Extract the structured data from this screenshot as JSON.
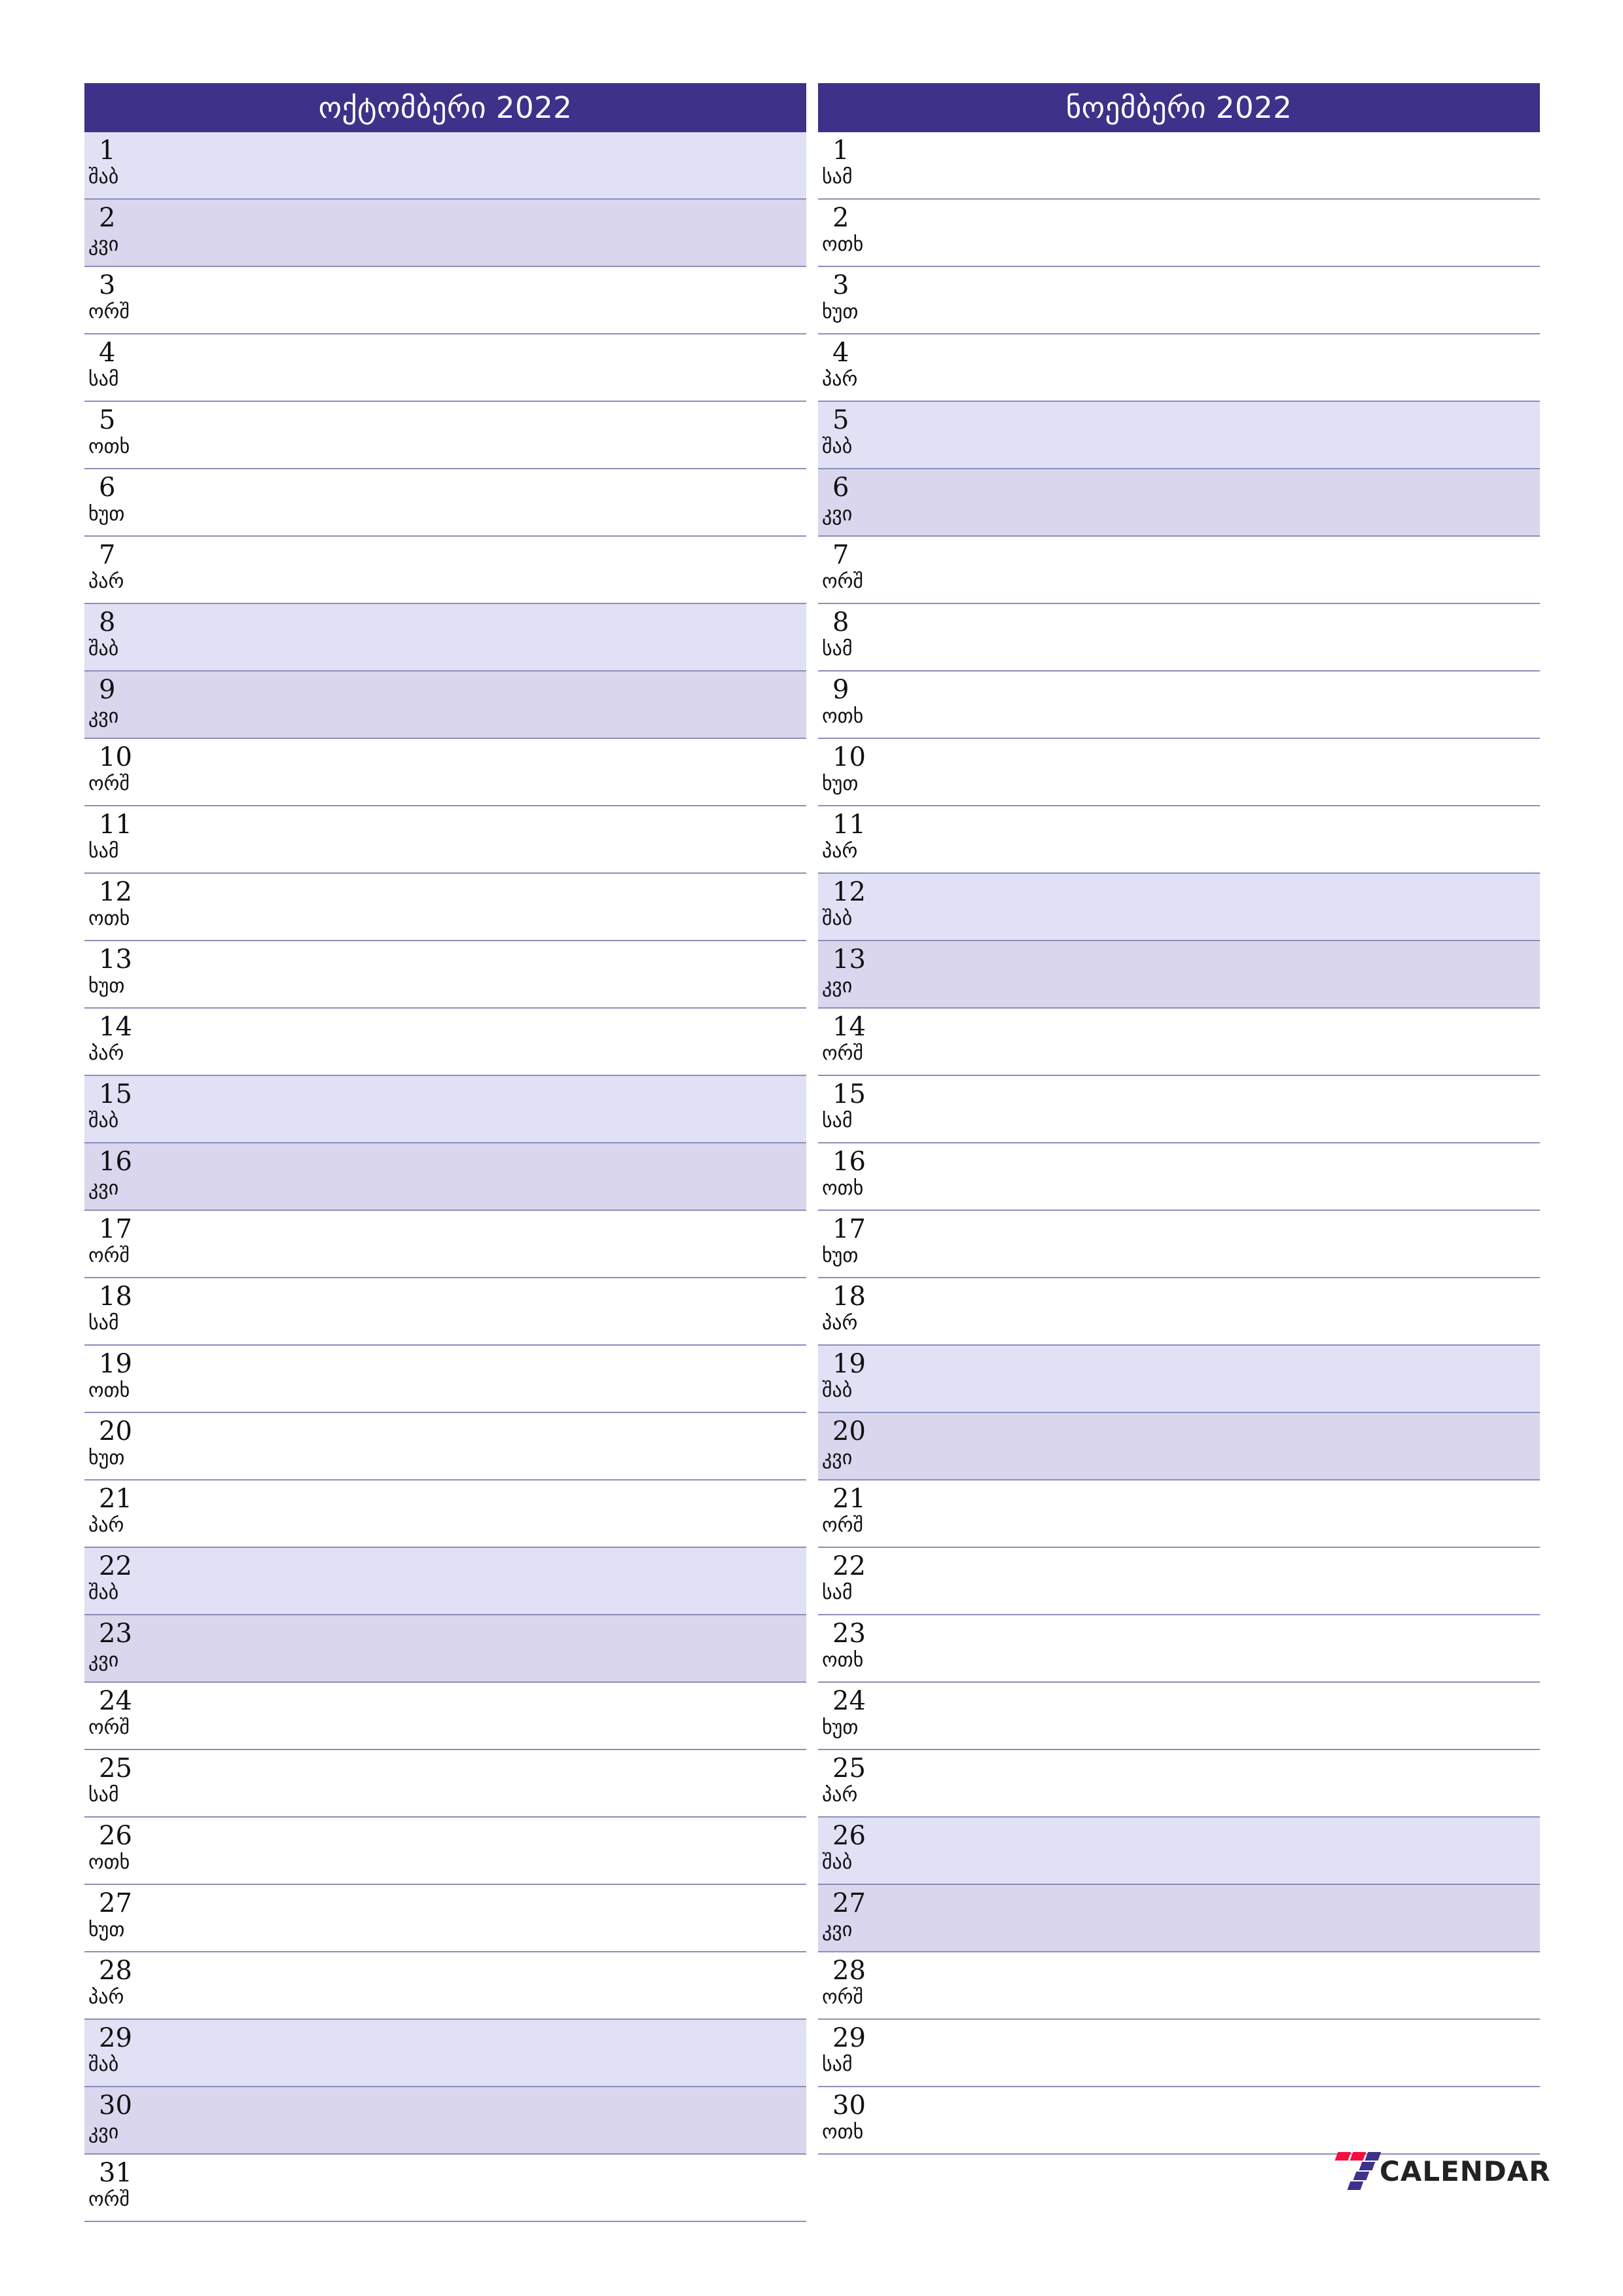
{
  "colors": {
    "header_bg": "#3d3189",
    "header_text": "#ffffff",
    "saturday_bg": "#e0e1f5",
    "sunday_bg": "#d9d6ed",
    "row_line": "#8f8cba",
    "brand_red": "#f40f3e",
    "brand_purple": "#3d3189"
  },
  "brand": {
    "name": "CALENDAR",
    "mark": "seven-logo-icon"
  },
  "months": [
    {
      "title": "ოქტომბერი 2022",
      "days": [
        {
          "num": "1",
          "weekday": "შაბ",
          "type": "sat"
        },
        {
          "num": "2",
          "weekday": "კვი",
          "type": "sun"
        },
        {
          "num": "3",
          "weekday": "ორშ",
          "type": "wd"
        },
        {
          "num": "4",
          "weekday": "სამ",
          "type": "wd"
        },
        {
          "num": "5",
          "weekday": "ოთხ",
          "type": "wd"
        },
        {
          "num": "6",
          "weekday": "ხუთ",
          "type": "wd"
        },
        {
          "num": "7",
          "weekday": "პარ",
          "type": "wd"
        },
        {
          "num": "8",
          "weekday": "შაბ",
          "type": "sat"
        },
        {
          "num": "9",
          "weekday": "კვი",
          "type": "sun"
        },
        {
          "num": "10",
          "weekday": "ორშ",
          "type": "wd"
        },
        {
          "num": "11",
          "weekday": "სამ",
          "type": "wd"
        },
        {
          "num": "12",
          "weekday": "ოთხ",
          "type": "wd"
        },
        {
          "num": "13",
          "weekday": "ხუთ",
          "type": "wd"
        },
        {
          "num": "14",
          "weekday": "პარ",
          "type": "wd"
        },
        {
          "num": "15",
          "weekday": "შაბ",
          "type": "sat"
        },
        {
          "num": "16",
          "weekday": "კვი",
          "type": "sun"
        },
        {
          "num": "17",
          "weekday": "ორშ",
          "type": "wd"
        },
        {
          "num": "18",
          "weekday": "სამ",
          "type": "wd"
        },
        {
          "num": "19",
          "weekday": "ოთხ",
          "type": "wd"
        },
        {
          "num": "20",
          "weekday": "ხუთ",
          "type": "wd"
        },
        {
          "num": "21",
          "weekday": "პარ",
          "type": "wd"
        },
        {
          "num": "22",
          "weekday": "შაბ",
          "type": "sat"
        },
        {
          "num": "23",
          "weekday": "კვი",
          "type": "sun"
        },
        {
          "num": "24",
          "weekday": "ორშ",
          "type": "wd"
        },
        {
          "num": "25",
          "weekday": "სამ",
          "type": "wd"
        },
        {
          "num": "26",
          "weekday": "ოთხ",
          "type": "wd"
        },
        {
          "num": "27",
          "weekday": "ხუთ",
          "type": "wd"
        },
        {
          "num": "28",
          "weekday": "პარ",
          "type": "wd"
        },
        {
          "num": "29",
          "weekday": "შაბ",
          "type": "sat"
        },
        {
          "num": "30",
          "weekday": "კვი",
          "type": "sun"
        },
        {
          "num": "31",
          "weekday": "ორშ",
          "type": "wd"
        }
      ]
    },
    {
      "title": "ნოემბერი 2022",
      "days": [
        {
          "num": "1",
          "weekday": "სამ",
          "type": "wd"
        },
        {
          "num": "2",
          "weekday": "ოთხ",
          "type": "wd"
        },
        {
          "num": "3",
          "weekday": "ხუთ",
          "type": "wd"
        },
        {
          "num": "4",
          "weekday": "პარ",
          "type": "wd"
        },
        {
          "num": "5",
          "weekday": "შაბ",
          "type": "sat"
        },
        {
          "num": "6",
          "weekday": "კვი",
          "type": "sun"
        },
        {
          "num": "7",
          "weekday": "ორშ",
          "type": "wd"
        },
        {
          "num": "8",
          "weekday": "სამ",
          "type": "wd"
        },
        {
          "num": "9",
          "weekday": "ოთხ",
          "type": "wd"
        },
        {
          "num": "10",
          "weekday": "ხუთ",
          "type": "wd"
        },
        {
          "num": "11",
          "weekday": "პარ",
          "type": "wd"
        },
        {
          "num": "12",
          "weekday": "შაბ",
          "type": "sat"
        },
        {
          "num": "13",
          "weekday": "კვი",
          "type": "sun"
        },
        {
          "num": "14",
          "weekday": "ორშ",
          "type": "wd"
        },
        {
          "num": "15",
          "weekday": "სამ",
          "type": "wd"
        },
        {
          "num": "16",
          "weekday": "ოთხ",
          "type": "wd"
        },
        {
          "num": "17",
          "weekday": "ხუთ",
          "type": "wd"
        },
        {
          "num": "18",
          "weekday": "პარ",
          "type": "wd"
        },
        {
          "num": "19",
          "weekday": "შაბ",
          "type": "sat"
        },
        {
          "num": "20",
          "weekday": "კვი",
          "type": "sun"
        },
        {
          "num": "21",
          "weekday": "ორშ",
          "type": "wd"
        },
        {
          "num": "22",
          "weekday": "სამ",
          "type": "wd"
        },
        {
          "num": "23",
          "weekday": "ოთხ",
          "type": "wd"
        },
        {
          "num": "24",
          "weekday": "ხუთ",
          "type": "wd"
        },
        {
          "num": "25",
          "weekday": "პარ",
          "type": "wd"
        },
        {
          "num": "26",
          "weekday": "შაბ",
          "type": "sat"
        },
        {
          "num": "27",
          "weekday": "კვი",
          "type": "sun"
        },
        {
          "num": "28",
          "weekday": "ორშ",
          "type": "wd"
        },
        {
          "num": "29",
          "weekday": "სამ",
          "type": "wd"
        },
        {
          "num": "30",
          "weekday": "ოთხ",
          "type": "wd"
        }
      ]
    }
  ]
}
